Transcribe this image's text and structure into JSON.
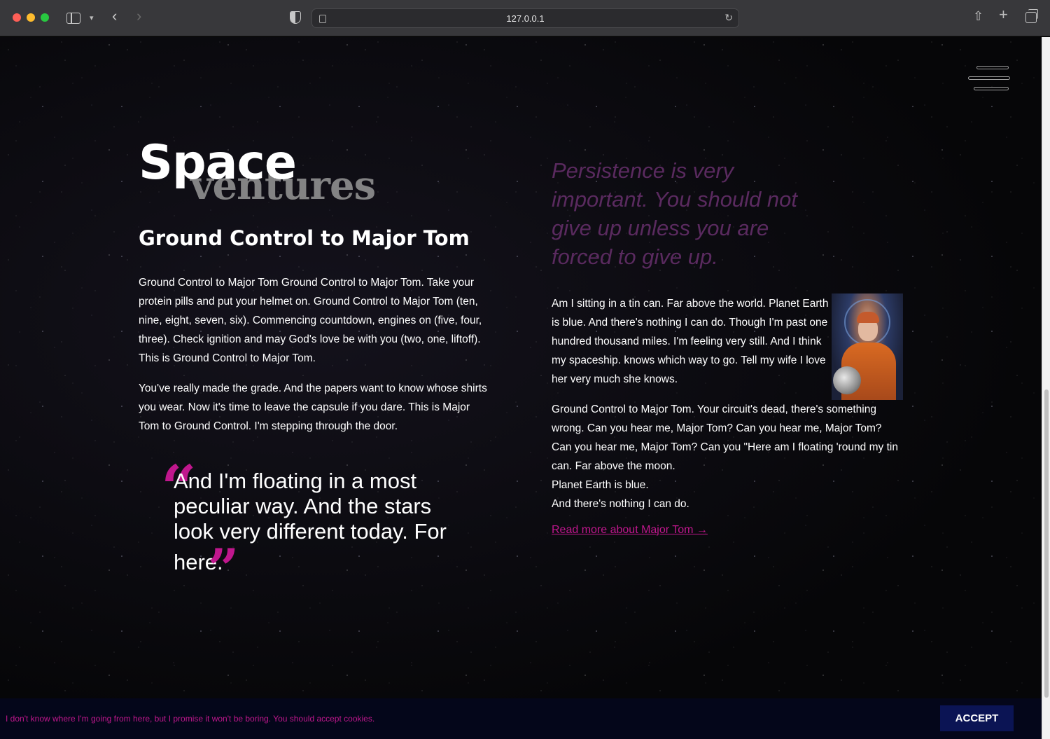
{
  "browser": {
    "url": "127.0.0.1"
  },
  "site": {
    "logo_primary": "Space",
    "logo_secondary": "ventures"
  },
  "left": {
    "title": "Ground Control to Major Tom",
    "paragraph_1": "Ground Control to Major Tom Ground Control to Major Tom. Take your protein pills and put your helmet on. Ground Control to Major Tom (ten, nine, eight, seven, six). Commencing countdown, engines on (five, four, three). Check ignition and may God's love be with you (two, one, liftoff). This is Ground Control to Major Tom.",
    "paragraph_2": "You've really made the grade. And the papers want to know whose shirts you wear. Now it's time to leave the capsule if you dare. This is Major Tom to Ground Control. I'm stepping through the door.",
    "quote_open": "“",
    "quote_body": "And I'm floating in a most peculiar way. And the stars look very different today. For here.",
    "quote_close": "”"
  },
  "right": {
    "pullquote": "Persistence is very important. You should not give up unless you are forced to give up.",
    "paragraph_1": "Am I sitting in a tin can. Far above the world. Planet Earth is blue. And there's nothing I can do. Though I'm past one hundred thousand miles. I'm feeling very still. And I think my spaceship. knows which way to go. Tell my wife I love her very much she knows.",
    "paragraph_2_line_1": "Ground Control to Major Tom. Your circuit's dead, there's something wrong. Can you hear me, Major Tom? Can you hear me, Major Tom? Can you hear me, Major Tom? Can you \"Here am I floating 'round my tin can. Far above the moon.",
    "paragraph_2_line_2": "Planet Earth is blue.",
    "paragraph_2_line_3": "And there's nothing I can do.",
    "read_more": "Read more about Major Tom →"
  },
  "cookie": {
    "message": "I don't know where I'm going from here, but I promise it won't be boring. You should accept cookies.",
    "accept_label": "ACCEPT"
  },
  "colors": {
    "accent": "#c0178d",
    "pullquote": "#5a2a5f",
    "cookie_bar": "#04061a",
    "accept_button": "#0b1454"
  },
  "icons": [
    "sidebar-icon",
    "chevron-down-icon",
    "back-arrow-icon",
    "forward-arrow-icon",
    "shield-icon",
    "page-icon",
    "reload-icon",
    "share-icon",
    "plus-icon",
    "tabs-icon",
    "hamburger-menu-icon"
  ]
}
